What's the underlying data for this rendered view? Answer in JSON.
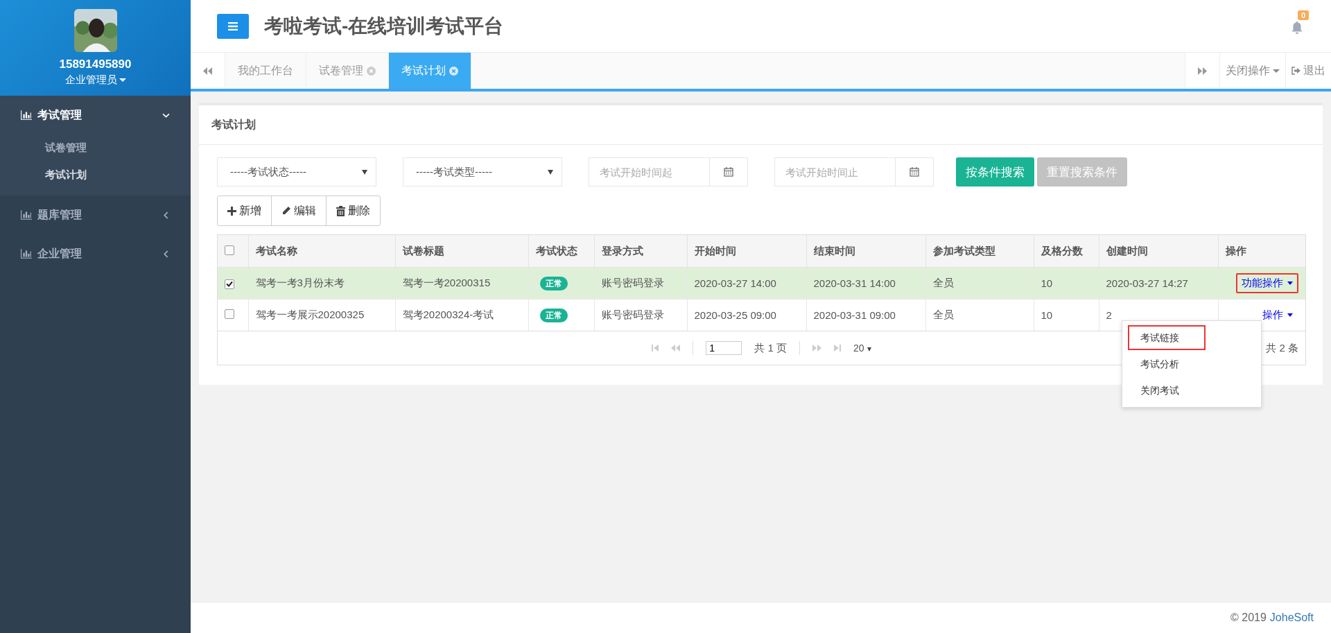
{
  "sidebar": {
    "user": {
      "phone": "15891495890",
      "role": "企业管理员"
    },
    "menu": [
      {
        "label": "考试管理",
        "expanded": true,
        "children": [
          {
            "label": "试卷管理",
            "selected": false
          },
          {
            "label": "考试计划",
            "selected": true
          }
        ]
      },
      {
        "label": "题库管理",
        "expanded": false
      },
      {
        "label": "企业管理",
        "expanded": false
      }
    ]
  },
  "header": {
    "title": "考啦考试-在线培训考试平台",
    "notification_count": "0"
  },
  "tabs": [
    {
      "label": "我的工作台",
      "selected": false,
      "closable": false
    },
    {
      "label": "试卷管理",
      "selected": false,
      "closable": true
    },
    {
      "label": "考试计划",
      "selected": true,
      "closable": true
    }
  ],
  "tab_bar": {
    "close_menu": "关闭操作",
    "logout": "退出"
  },
  "panel": {
    "title": "考试计划",
    "filters": [
      {
        "kind": "select",
        "value": "-----考试状态-----"
      },
      {
        "kind": "select",
        "value": "-----考试类型-----"
      },
      {
        "kind": "date",
        "placeholder": "考试开始时间起"
      },
      {
        "kind": "date",
        "placeholder": "考试开始时间止"
      }
    ],
    "buttons": [
      {
        "label": "按条件搜索",
        "disabled": false
      },
      {
        "label": "重置搜索条件",
        "disabled": true
      }
    ],
    "toolbar": [
      {
        "kind": "add",
        "label": "新增"
      },
      {
        "kind": "edit",
        "label": "编辑"
      },
      {
        "kind": "delete",
        "label": "删除"
      }
    ],
    "table": {
      "all_checked": false,
      "columns": [
        "考试名称",
        "试卷标题",
        "考试状态",
        "登录方式",
        "开始时间",
        "结束时间",
        "参加考试类型",
        "及格分数",
        "创建时间",
        "操作"
      ],
      "rows": [
        {
          "selected": true,
          "cells": [
            "驾考一考3月份末考",
            "驾考一考20200315",
            "正常",
            "账号密码登录",
            "2020-03-27 14:00",
            "2020-03-31 14:00",
            "全员",
            "10",
            "2020-03-27 14:27"
          ],
          "action": "功能操作",
          "highlighted": true
        },
        {
          "selected": false,
          "cells": [
            "驾考一考展示20200325",
            "驾考20200324-考试",
            "正常",
            "账号密码登录",
            "2020-03-25 09:00",
            "2020-03-31 09:00",
            "全员",
            "10",
            "2"
          ],
          "action": "操作",
          "highlighted": false
        }
      ]
    },
    "pagination": {
      "page": "1",
      "pages": "共 1 页",
      "page_size": "20",
      "total": "共 2 条"
    },
    "dropdown": [
      {
        "label": "考试链接",
        "highlighted": true
      },
      {
        "label": "考试分析",
        "highlighted": false
      },
      {
        "label": "关闭考试",
        "highlighted": false
      }
    ]
  },
  "footer": {
    "copyright": "© 2019",
    "company": "JoheSoft"
  }
}
